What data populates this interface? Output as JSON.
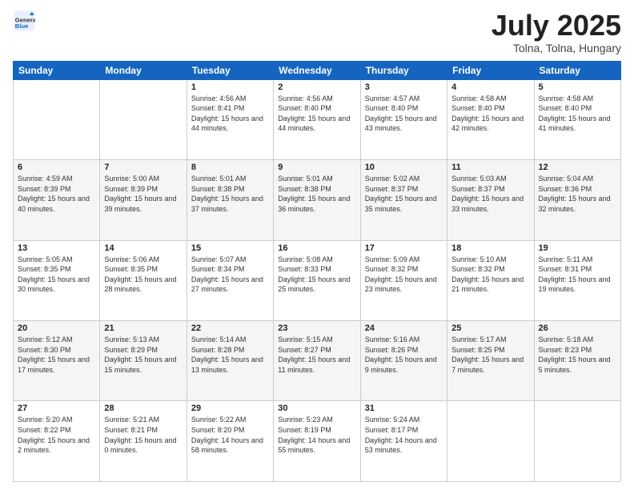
{
  "header": {
    "logo_general": "General",
    "logo_blue": "Blue",
    "title": "July 2025",
    "subtitle": "Tolna, Tolna, Hungary"
  },
  "weekdays": [
    "Sunday",
    "Monday",
    "Tuesday",
    "Wednesday",
    "Thursday",
    "Friday",
    "Saturday"
  ],
  "rows": [
    [
      {
        "day": "",
        "sunrise": "",
        "sunset": "",
        "daylight": ""
      },
      {
        "day": "",
        "sunrise": "",
        "sunset": "",
        "daylight": ""
      },
      {
        "day": "1",
        "sunrise": "Sunrise: 4:56 AM",
        "sunset": "Sunset: 8:41 PM",
        "daylight": "Daylight: 15 hours and 44 minutes."
      },
      {
        "day": "2",
        "sunrise": "Sunrise: 4:56 AM",
        "sunset": "Sunset: 8:40 PM",
        "daylight": "Daylight: 15 hours and 44 minutes."
      },
      {
        "day": "3",
        "sunrise": "Sunrise: 4:57 AM",
        "sunset": "Sunset: 8:40 PM",
        "daylight": "Daylight: 15 hours and 43 minutes."
      },
      {
        "day": "4",
        "sunrise": "Sunrise: 4:58 AM",
        "sunset": "Sunset: 8:40 PM",
        "daylight": "Daylight: 15 hours and 42 minutes."
      },
      {
        "day": "5",
        "sunrise": "Sunrise: 4:58 AM",
        "sunset": "Sunset: 8:40 PM",
        "daylight": "Daylight: 15 hours and 41 minutes."
      }
    ],
    [
      {
        "day": "6",
        "sunrise": "Sunrise: 4:59 AM",
        "sunset": "Sunset: 8:39 PM",
        "daylight": "Daylight: 15 hours and 40 minutes."
      },
      {
        "day": "7",
        "sunrise": "Sunrise: 5:00 AM",
        "sunset": "Sunset: 8:39 PM",
        "daylight": "Daylight: 15 hours and 39 minutes."
      },
      {
        "day": "8",
        "sunrise": "Sunrise: 5:01 AM",
        "sunset": "Sunset: 8:38 PM",
        "daylight": "Daylight: 15 hours and 37 minutes."
      },
      {
        "day": "9",
        "sunrise": "Sunrise: 5:01 AM",
        "sunset": "Sunset: 8:38 PM",
        "daylight": "Daylight: 15 hours and 36 minutes."
      },
      {
        "day": "10",
        "sunrise": "Sunrise: 5:02 AM",
        "sunset": "Sunset: 8:37 PM",
        "daylight": "Daylight: 15 hours and 35 minutes."
      },
      {
        "day": "11",
        "sunrise": "Sunrise: 5:03 AM",
        "sunset": "Sunset: 8:37 PM",
        "daylight": "Daylight: 15 hours and 33 minutes."
      },
      {
        "day": "12",
        "sunrise": "Sunrise: 5:04 AM",
        "sunset": "Sunset: 8:36 PM",
        "daylight": "Daylight: 15 hours and 32 minutes."
      }
    ],
    [
      {
        "day": "13",
        "sunrise": "Sunrise: 5:05 AM",
        "sunset": "Sunset: 8:35 PM",
        "daylight": "Daylight: 15 hours and 30 minutes."
      },
      {
        "day": "14",
        "sunrise": "Sunrise: 5:06 AM",
        "sunset": "Sunset: 8:35 PM",
        "daylight": "Daylight: 15 hours and 28 minutes."
      },
      {
        "day": "15",
        "sunrise": "Sunrise: 5:07 AM",
        "sunset": "Sunset: 8:34 PM",
        "daylight": "Daylight: 15 hours and 27 minutes."
      },
      {
        "day": "16",
        "sunrise": "Sunrise: 5:08 AM",
        "sunset": "Sunset: 8:33 PM",
        "daylight": "Daylight: 15 hours and 25 minutes."
      },
      {
        "day": "17",
        "sunrise": "Sunrise: 5:09 AM",
        "sunset": "Sunset: 8:32 PM",
        "daylight": "Daylight: 15 hours and 23 minutes."
      },
      {
        "day": "18",
        "sunrise": "Sunrise: 5:10 AM",
        "sunset": "Sunset: 8:32 PM",
        "daylight": "Daylight: 15 hours and 21 minutes."
      },
      {
        "day": "19",
        "sunrise": "Sunrise: 5:11 AM",
        "sunset": "Sunset: 8:31 PM",
        "daylight": "Daylight: 15 hours and 19 minutes."
      }
    ],
    [
      {
        "day": "20",
        "sunrise": "Sunrise: 5:12 AM",
        "sunset": "Sunset: 8:30 PM",
        "daylight": "Daylight: 15 hours and 17 minutes."
      },
      {
        "day": "21",
        "sunrise": "Sunrise: 5:13 AM",
        "sunset": "Sunset: 8:29 PM",
        "daylight": "Daylight: 15 hours and 15 minutes."
      },
      {
        "day": "22",
        "sunrise": "Sunrise: 5:14 AM",
        "sunset": "Sunset: 8:28 PM",
        "daylight": "Daylight: 15 hours and 13 minutes."
      },
      {
        "day": "23",
        "sunrise": "Sunrise: 5:15 AM",
        "sunset": "Sunset: 8:27 PM",
        "daylight": "Daylight: 15 hours and 11 minutes."
      },
      {
        "day": "24",
        "sunrise": "Sunrise: 5:16 AM",
        "sunset": "Sunset: 8:26 PM",
        "daylight": "Daylight: 15 hours and 9 minutes."
      },
      {
        "day": "25",
        "sunrise": "Sunrise: 5:17 AM",
        "sunset": "Sunset: 8:25 PM",
        "daylight": "Daylight: 15 hours and 7 minutes."
      },
      {
        "day": "26",
        "sunrise": "Sunrise: 5:18 AM",
        "sunset": "Sunset: 8:23 PM",
        "daylight": "Daylight: 15 hours and 5 minutes."
      }
    ],
    [
      {
        "day": "27",
        "sunrise": "Sunrise: 5:20 AM",
        "sunset": "Sunset: 8:22 PM",
        "daylight": "Daylight: 15 hours and 2 minutes."
      },
      {
        "day": "28",
        "sunrise": "Sunrise: 5:21 AM",
        "sunset": "Sunset: 8:21 PM",
        "daylight": "Daylight: 15 hours and 0 minutes."
      },
      {
        "day": "29",
        "sunrise": "Sunrise: 5:22 AM",
        "sunset": "Sunset: 8:20 PM",
        "daylight": "Daylight: 14 hours and 58 minutes."
      },
      {
        "day": "30",
        "sunrise": "Sunrise: 5:23 AM",
        "sunset": "Sunset: 8:19 PM",
        "daylight": "Daylight: 14 hours and 55 minutes."
      },
      {
        "day": "31",
        "sunrise": "Sunrise: 5:24 AM",
        "sunset": "Sunset: 8:17 PM",
        "daylight": "Daylight: 14 hours and 53 minutes."
      },
      {
        "day": "",
        "sunrise": "",
        "sunset": "",
        "daylight": ""
      },
      {
        "day": "",
        "sunrise": "",
        "sunset": "",
        "daylight": ""
      }
    ]
  ]
}
